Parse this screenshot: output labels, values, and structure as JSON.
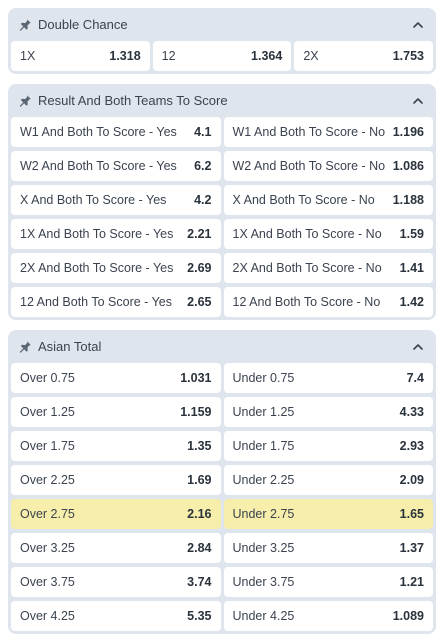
{
  "markets": [
    {
      "title": "Double Chance",
      "columns": 3,
      "outcomes": [
        {
          "label": "1X",
          "odds": "1.318"
        },
        {
          "label": "12",
          "odds": "1.364"
        },
        {
          "label": "2X",
          "odds": "1.753"
        }
      ]
    },
    {
      "title": "Result And Both Teams To Score",
      "columns": 2,
      "outcomes": [
        {
          "label": "W1 And Both To Score - Yes",
          "odds": "4.1"
        },
        {
          "label": "W1 And Both To Score - No",
          "odds": "1.196"
        },
        {
          "label": "W2 And Both To Score - Yes",
          "odds": "6.2"
        },
        {
          "label": "W2 And Both To Score - No",
          "odds": "1.086"
        },
        {
          "label": "X And Both To Score - Yes",
          "odds": "4.2"
        },
        {
          "label": "X And Both To Score - No",
          "odds": "1.188"
        },
        {
          "label": "1X And Both To Score - Yes",
          "odds": "2.21"
        },
        {
          "label": "1X And Both To Score - No",
          "odds": "1.59"
        },
        {
          "label": "2X And Both To Score - Yes",
          "odds": "2.69"
        },
        {
          "label": "2X And Both To Score - No",
          "odds": "1.41"
        },
        {
          "label": "12 And Both To Score - Yes",
          "odds": "2.65"
        },
        {
          "label": "12 And Both To Score - No",
          "odds": "1.42"
        }
      ]
    },
    {
      "title": "Asian Total",
      "columns": 2,
      "outcomes": [
        {
          "label": "Over 0.75",
          "odds": "1.031"
        },
        {
          "label": "Under 0.75",
          "odds": "7.4"
        },
        {
          "label": "Over 1.25",
          "odds": "1.159"
        },
        {
          "label": "Under 1.25",
          "odds": "4.33"
        },
        {
          "label": "Over 1.75",
          "odds": "1.35"
        },
        {
          "label": "Under 1.75",
          "odds": "2.93"
        },
        {
          "label": "Over 2.25",
          "odds": "1.69"
        },
        {
          "label": "Under 2.25",
          "odds": "2.09"
        },
        {
          "label": "Over 2.75",
          "odds": "2.16",
          "highlighted": true
        },
        {
          "label": "Under 2.75",
          "odds": "1.65",
          "highlighted": true
        },
        {
          "label": "Over 3.25",
          "odds": "2.84"
        },
        {
          "label": "Under 3.25",
          "odds": "1.37"
        },
        {
          "label": "Over 3.75",
          "odds": "3.74"
        },
        {
          "label": "Under 3.75",
          "odds": "1.21"
        },
        {
          "label": "Over 4.25",
          "odds": "5.35"
        },
        {
          "label": "Under 4.25",
          "odds": "1.089"
        }
      ]
    }
  ],
  "icons": {
    "pin": "pin-icon",
    "collapse": "chevron-up-icon"
  },
  "colors": {
    "panel": "#dfe5ec",
    "cell": "#ffffff",
    "highlight": "#f6eeaa"
  }
}
